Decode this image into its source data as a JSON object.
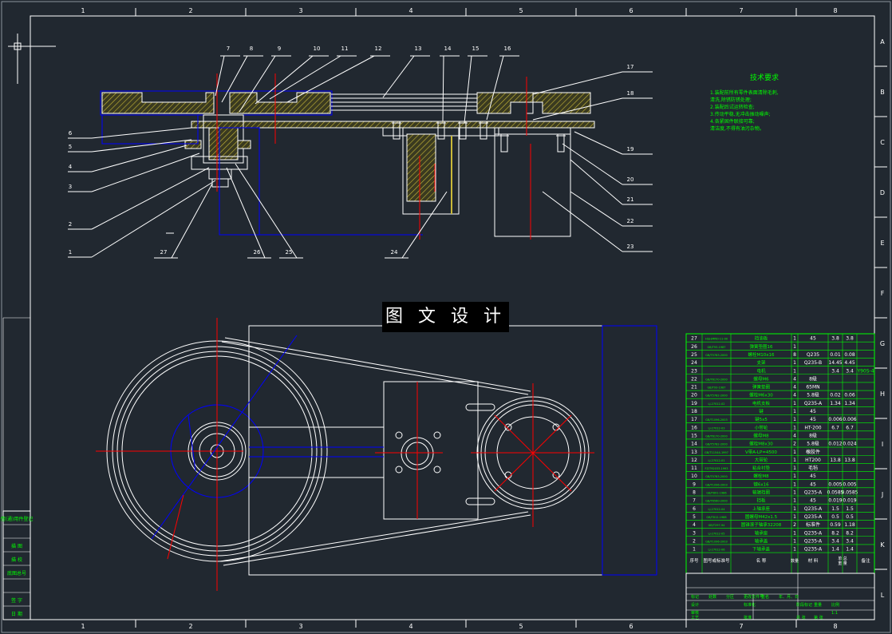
{
  "banner": "图 文 设 计",
  "grid_cols": [
    "1",
    "2",
    "3",
    "4",
    "5",
    "6",
    "7",
    "8"
  ],
  "grid_rows": [
    "A",
    "B",
    "C",
    "D",
    "E",
    "F",
    "G",
    "H",
    "I",
    "J",
    "K",
    "L"
  ],
  "colors": {
    "background": "#212830",
    "line": "#ffffff",
    "green": "#00ff00",
    "blue": "#0000ff",
    "red": "#ff0000",
    "yellow": "#d9c640",
    "hatch": "#c8b838"
  },
  "tech_title": "技术要求",
  "tech_lines": [
    "1.装配前所有零件表面清除毛刺,",
    "清洗,除锈防锈处理;",
    "2.装配后试运转检查;",
    "3.传动平稳,无冲击振动噪声;",
    "4.各紧固件联接可靠;",
    "清洁度,不得有油污杂物。"
  ],
  "leaders_top": [
    "7",
    "8",
    "9",
    "10",
    "11",
    "12",
    "13",
    "14",
    "15",
    "16"
  ],
  "leaders_right": [
    "17",
    "18",
    "19",
    "20",
    "21",
    "22",
    "23"
  ],
  "leaders_left": [
    "6",
    "5",
    "4",
    "3",
    "2",
    "1"
  ],
  "leaders_bottom": [
    "27",
    "26",
    "25",
    "24"
  ],
  "left_labels": [
    "借(通)用件登记",
    "",
    "描 图",
    "描 校",
    "底图总号",
    "",
    "签 字",
    "日 期"
  ],
  "bom_rows": [
    {
      "no": "27",
      "code": "HSJ-JMPJ0-11-00",
      "name": "挡油板",
      "qty": "1",
      "mat": "45",
      "w1": "3.8",
      "w2": "3.8",
      "note": ""
    },
    {
      "no": "26",
      "code": "GB/T93-1987",
      "name": "弹簧垫圈16",
      "qty": "1",
      "mat": "",
      "w1": "",
      "w2": "",
      "note": ""
    },
    {
      "no": "25",
      "code": "GB/T5783-2000",
      "name": "螺栓M10x16",
      "qty": "8",
      "mat": "Q235",
      "w1": "0.01",
      "w2": "0.08",
      "note": ""
    },
    {
      "no": "24",
      "code": "",
      "name": "支架",
      "qty": "1",
      "mat": "Q235-B",
      "w1": "14.45",
      "w2": "4.45",
      "note": ""
    },
    {
      "no": "23",
      "code": "",
      "name": "电机",
      "qty": "1",
      "mat": "",
      "w1": "3.4",
      "w2": "3.4",
      "note": "Y90S-4"
    },
    {
      "no": "22",
      "code": "GB/T6170-2000",
      "name": "螺母M6",
      "qty": "4",
      "mat": "8级",
      "w1": "",
      "w2": "",
      "note": ""
    },
    {
      "no": "21",
      "code": "GB/T93-1987",
      "name": "弹簧垫圈",
      "qty": "4",
      "mat": "65MN",
      "w1": "",
      "w2": "",
      "note": ""
    },
    {
      "no": "20",
      "code": "GB/T5782-2000",
      "name": "螺栓M6x30",
      "qty": "4",
      "mat": "5.8级",
      "w1": "0.02",
      "w2": "0.06",
      "note": ""
    },
    {
      "no": "19",
      "code": "LJ-27012-02",
      "name": "电机支板",
      "qty": "1",
      "mat": "Q235-A",
      "w1": "1.34",
      "w2": "1.34",
      "note": ""
    },
    {
      "no": "18",
      "code": "",
      "name": "键",
      "qty": "1",
      "mat": "45",
      "w1": "",
      "w2": "",
      "note": ""
    },
    {
      "no": "17",
      "code": "GB/T1096-2003",
      "name": "键5x5",
      "qty": "1",
      "mat": "45",
      "w1": "0.006",
      "w2": "0.006",
      "note": ""
    },
    {
      "no": "16",
      "code": "LJ-27012-03",
      "name": "小带轮",
      "qty": "1",
      "mat": "HT-200",
      "w1": "6.7",
      "w2": "6.7",
      "note": ""
    },
    {
      "no": "15",
      "code": "GB/T6170-2000",
      "name": "螺母M8",
      "qty": "4",
      "mat": "8级",
      "w1": "",
      "w2": "",
      "note": ""
    },
    {
      "no": "14",
      "code": "GB/T5782-2000",
      "name": "螺栓M8x30",
      "qty": "2",
      "mat": "5.8级",
      "w1": "0.012",
      "w2": "0.024",
      "note": ""
    },
    {
      "no": "13",
      "code": "GB/T11544-1997",
      "name": "V带A-LP=4500",
      "qty": "1",
      "mat": "橡胶件",
      "w1": "",
      "w2": "",
      "note": ""
    },
    {
      "no": "12",
      "code": "LJ-27012-01",
      "name": "大带轮",
      "qty": "1",
      "mat": "HT200",
      "w1": "13.8",
      "w2": "13.8",
      "note": ""
    },
    {
      "no": "11",
      "code": "FZ/T92033-1993",
      "name": "粘合衬垫",
      "qty": "1",
      "mat": "毛毡",
      "w1": "",
      "w2": "",
      "note": ""
    },
    {
      "no": "10",
      "code": "GB/T5783-2000",
      "name": "螺栓M8",
      "qty": "1",
      "mat": "45",
      "w1": "",
      "w2": "",
      "note": ""
    },
    {
      "no": "9",
      "code": "GB/T1096-2003",
      "name": "键6x16",
      "qty": "1",
      "mat": "45",
      "w1": "0.005",
      "w2": "0.005",
      "note": ""
    },
    {
      "no": "8",
      "code": "GB/T891-1986",
      "name": "轴端挡圈",
      "qty": "1",
      "mat": "Q235-A",
      "w1": "0.0585",
      "w2": "0.0585",
      "note": ""
    },
    {
      "no": "7",
      "code": "GB/T6560-2000",
      "name": "挡板",
      "qty": "1",
      "mat": "45",
      "w1": "0.019",
      "w2": "0.019",
      "note": ""
    },
    {
      "no": "6",
      "code": "LJ-27012-04",
      "name": "上轴承座",
      "qty": "1",
      "mat": "Q235-A",
      "w1": "1.5",
      "w2": "1.5",
      "note": ""
    },
    {
      "no": "5",
      "code": "GB/T812-1988",
      "name": "圆螺母M42x1.5",
      "qty": "1",
      "mat": "Q235-A",
      "w1": "0.5",
      "w2": "0.5",
      "note": ""
    },
    {
      "no": "4",
      "code": "GB/T297-94",
      "name": "圆锥滚子轴承32208",
      "qty": "2",
      "mat": "标准件",
      "w1": "0.59",
      "w2": "1.18",
      "note": ""
    },
    {
      "no": "3",
      "code": "LJ-27012-05",
      "name": "轴承座",
      "qty": "1",
      "mat": "Q235-A",
      "w1": "8.2",
      "w2": "8.2",
      "note": ""
    },
    {
      "no": "2",
      "code": "GB/T1096-2003",
      "name": "轴承盖",
      "qty": "1",
      "mat": "Q235-A",
      "w1": "3.4",
      "w2": "3.4",
      "note": ""
    },
    {
      "no": "1",
      "code": "LJ-27012-06",
      "name": "下轴承盖",
      "qty": "1",
      "mat": "Q235-A",
      "w1": "1.4",
      "w2": "1.4",
      "note": ""
    }
  ],
  "bom_header": {
    "no": "序号",
    "code": "图号或标准号",
    "name": "名 称",
    "qty": "数量",
    "mat": "材 料",
    "weight": "单 总",
    "weight_sub": "重 量",
    "note": "备注"
  },
  "title_block": {
    "r1": [
      "标记",
      "处数",
      "分区",
      "更改文件号",
      "签名",
      "年、月、日"
    ],
    "r2": [
      "设计",
      "",
      "",
      "标准化",
      "",
      "",
      "阶段标记",
      "重量",
      "比例"
    ],
    "r3": [
      "审核",
      "",
      "",
      "",
      "",
      "",
      "",
      "",
      "1:1"
    ],
    "r4": [
      "工艺",
      "",
      "",
      "批准",
      "",
      "",
      "共 张",
      "第 张"
    ]
  }
}
